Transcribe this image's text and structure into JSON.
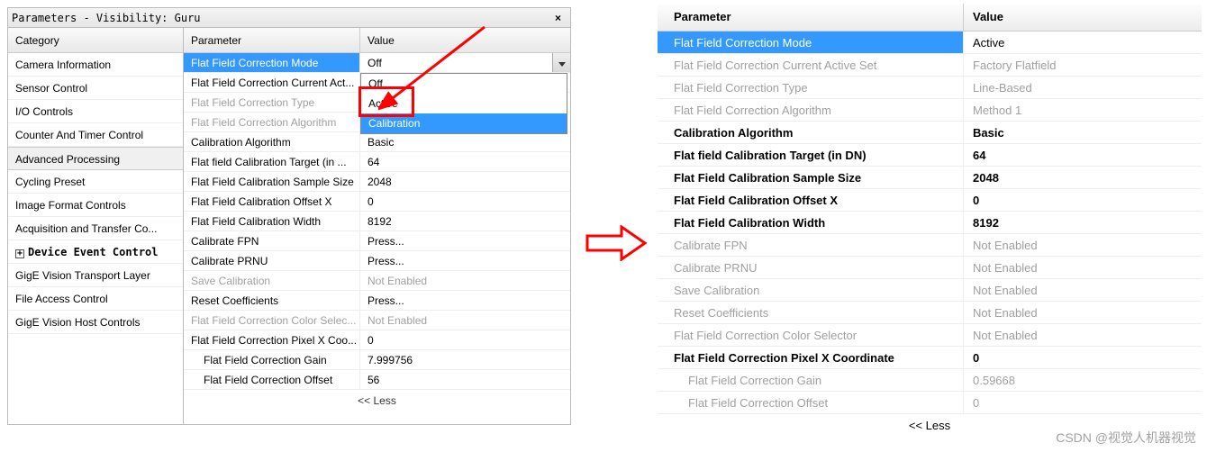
{
  "left": {
    "title": "Parameters - Visibility: Guru",
    "headers": {
      "category": "Category",
      "parameter": "Parameter",
      "value": "Value"
    },
    "categories": [
      {
        "label": "Camera Information",
        "selected": false,
        "bold": false,
        "expand": false
      },
      {
        "label": "Sensor Control",
        "selected": false,
        "bold": false,
        "expand": false
      },
      {
        "label": "I/O Controls",
        "selected": false,
        "bold": false,
        "expand": false
      },
      {
        "label": "Counter And Timer Control",
        "selected": false,
        "bold": false,
        "expand": false
      },
      {
        "label": "Advanced Processing",
        "selected": true,
        "bold": false,
        "expand": false
      },
      {
        "label": "Cycling Preset",
        "selected": false,
        "bold": false,
        "expand": false
      },
      {
        "label": "Image Format Controls",
        "selected": false,
        "bold": false,
        "expand": false
      },
      {
        "label": "Acquisition and Transfer Co...",
        "selected": false,
        "bold": false,
        "expand": false
      },
      {
        "label": "Device Event Control",
        "selected": false,
        "bold": true,
        "expand": true
      },
      {
        "label": "GigE Vision Transport Layer",
        "selected": false,
        "bold": false,
        "expand": false
      },
      {
        "label": "File Access Control",
        "selected": false,
        "bold": false,
        "expand": false
      },
      {
        "label": "GigE Vision Host Controls",
        "selected": false,
        "bold": false,
        "expand": false
      }
    ],
    "params": [
      {
        "name": "Flat Field Correction Mode",
        "value": "Off",
        "selected": true,
        "disabled": false,
        "indent": false,
        "hasDropdown": true
      },
      {
        "name": "Flat Field Correction Current Act...",
        "value": "",
        "selected": false,
        "disabled": false,
        "indent": false
      },
      {
        "name": "Flat Field Correction Type",
        "value": "",
        "selected": false,
        "disabled": true,
        "indent": false
      },
      {
        "name": "Flat Field Correction Algorithm",
        "value": "",
        "selected": false,
        "disabled": true,
        "indent": false
      },
      {
        "name": "Calibration Algorithm",
        "value": "Basic",
        "selected": false,
        "disabled": false,
        "indent": false
      },
      {
        "name": "Flat field Calibration Target (in ...",
        "value": "64",
        "selected": false,
        "disabled": false,
        "indent": false
      },
      {
        "name": "Flat Field Calibration Sample Size",
        "value": "2048",
        "selected": false,
        "disabled": false,
        "indent": false
      },
      {
        "name": "Flat Field Calibration Offset X",
        "value": "0",
        "selected": false,
        "disabled": false,
        "indent": false
      },
      {
        "name": "Flat Field Calibration Width",
        "value": "8192",
        "selected": false,
        "disabled": false,
        "indent": false
      },
      {
        "name": "Calibrate FPN",
        "value": "Press...",
        "selected": false,
        "disabled": false,
        "indent": false
      },
      {
        "name": "Calibrate PRNU",
        "value": "Press...",
        "selected": false,
        "disabled": false,
        "indent": false
      },
      {
        "name": "Save Calibration",
        "value": "Not Enabled",
        "selected": false,
        "disabled": true,
        "indent": false
      },
      {
        "name": "Reset Coefficients",
        "value": "Press...",
        "selected": false,
        "disabled": false,
        "indent": false
      },
      {
        "name": "Flat Field Correction Color Selec...",
        "value": "Not Enabled",
        "selected": false,
        "disabled": true,
        "indent": false
      },
      {
        "name": "Flat Field Correction Pixel X Coo...",
        "value": "0",
        "selected": false,
        "disabled": false,
        "indent": false
      },
      {
        "name": "Flat Field Correction Gain",
        "value": "7.999756",
        "selected": false,
        "disabled": false,
        "indent": true
      },
      {
        "name": "Flat Field Correction Offset",
        "value": "56",
        "selected": false,
        "disabled": false,
        "indent": true
      }
    ],
    "dropdown": {
      "options": [
        "Off",
        "Active",
        "Calibration"
      ],
      "highlight_index": 2
    },
    "less": "<< Less"
  },
  "right": {
    "headers": {
      "parameter": "Parameter",
      "value": "Value"
    },
    "rows": [
      {
        "name": "Flat Field Correction Mode",
        "value": "Active",
        "selected": true,
        "disabled": false,
        "bold": false,
        "indent": false
      },
      {
        "name": "Flat Field Correction Current Active Set",
        "value": "Factory Flatfield",
        "selected": false,
        "disabled": true,
        "bold": false,
        "indent": false
      },
      {
        "name": "Flat Field Correction Type",
        "value": "Line-Based",
        "selected": false,
        "disabled": true,
        "bold": false,
        "indent": false
      },
      {
        "name": "Flat Field Correction Algorithm",
        "value": "Method 1",
        "selected": false,
        "disabled": true,
        "bold": false,
        "indent": false
      },
      {
        "name": "Calibration Algorithm",
        "value": "Basic",
        "selected": false,
        "disabled": false,
        "bold": true,
        "indent": false
      },
      {
        "name": "Flat field Calibration Target (in DN)",
        "value": "64",
        "selected": false,
        "disabled": false,
        "bold": true,
        "indent": false
      },
      {
        "name": "Flat Field Calibration Sample Size",
        "value": "2048",
        "selected": false,
        "disabled": false,
        "bold": true,
        "indent": false
      },
      {
        "name": "Flat Field Calibration Offset X",
        "value": "0",
        "selected": false,
        "disabled": false,
        "bold": true,
        "indent": false
      },
      {
        "name": "Flat Field Calibration Width",
        "value": "8192",
        "selected": false,
        "disabled": false,
        "bold": true,
        "indent": false
      },
      {
        "name": "Calibrate FPN",
        "value": "Not Enabled",
        "selected": false,
        "disabled": true,
        "bold": false,
        "indent": false
      },
      {
        "name": "Calibrate PRNU",
        "value": "Not Enabled",
        "selected": false,
        "disabled": true,
        "bold": false,
        "indent": false
      },
      {
        "name": "Save Calibration",
        "value": "Not Enabled",
        "selected": false,
        "disabled": true,
        "bold": false,
        "indent": false
      },
      {
        "name": "Reset Coefficients",
        "value": "Not Enabled",
        "selected": false,
        "disabled": true,
        "bold": false,
        "indent": false
      },
      {
        "name": "Flat Field Correction Color Selector",
        "value": "Not Enabled",
        "selected": false,
        "disabled": true,
        "bold": false,
        "indent": false
      },
      {
        "name": "Flat Field Correction Pixel X Coordinate",
        "value": "0",
        "selected": false,
        "disabled": false,
        "bold": true,
        "indent": false
      },
      {
        "name": "Flat Field Correction Gain",
        "value": "0.59668",
        "selected": false,
        "disabled": true,
        "bold": false,
        "indent": true
      },
      {
        "name": "Flat Field Correction Offset",
        "value": "0",
        "selected": false,
        "disabled": true,
        "bold": false,
        "indent": true
      }
    ],
    "less": "<< Less"
  },
  "watermark": "CSDN @视觉人机器视觉"
}
